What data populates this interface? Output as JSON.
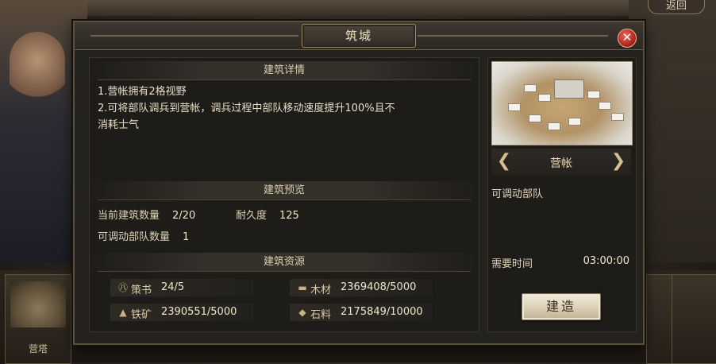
{
  "dialog": {
    "title": "筑城",
    "close_label": "✕"
  },
  "details": {
    "heading": "建筑详情",
    "lines": [
      "1.营帐拥有2格视野",
      "2.可将部队调兵到营帐，调兵过程中部队移动速度提升100%且不",
      "消耗士气"
    ]
  },
  "preview_section": {
    "heading": "建筑预览",
    "current_count_label": "当前建筑数量",
    "current_count_value": "2/20",
    "durability_label": "耐久度",
    "durability_value": "125",
    "deployable_label": "可调动部队数量",
    "deployable_value": "1"
  },
  "resources": {
    "heading": "建筑资源",
    "items": [
      {
        "icon": "book-seal-icon",
        "glyph": "㊇",
        "name": "策书",
        "value": "24/5"
      },
      {
        "icon": "wood-icon",
        "glyph": "▬",
        "name": "木材",
        "value": "2369408/5000"
      },
      {
        "icon": "iron-icon",
        "glyph": "▲",
        "name": "铁矿",
        "value": "2390551/5000"
      },
      {
        "icon": "stone-icon",
        "glyph": "◆",
        "name": "石料",
        "value": "2175849/10000"
      }
    ]
  },
  "building": {
    "name": "营帐",
    "function": "可调动部队",
    "time_label": "需要时间",
    "time_value": "03:00:00",
    "build_label": "建造"
  },
  "background": {
    "return_label": "返回",
    "left_card_label": "营塔"
  }
}
